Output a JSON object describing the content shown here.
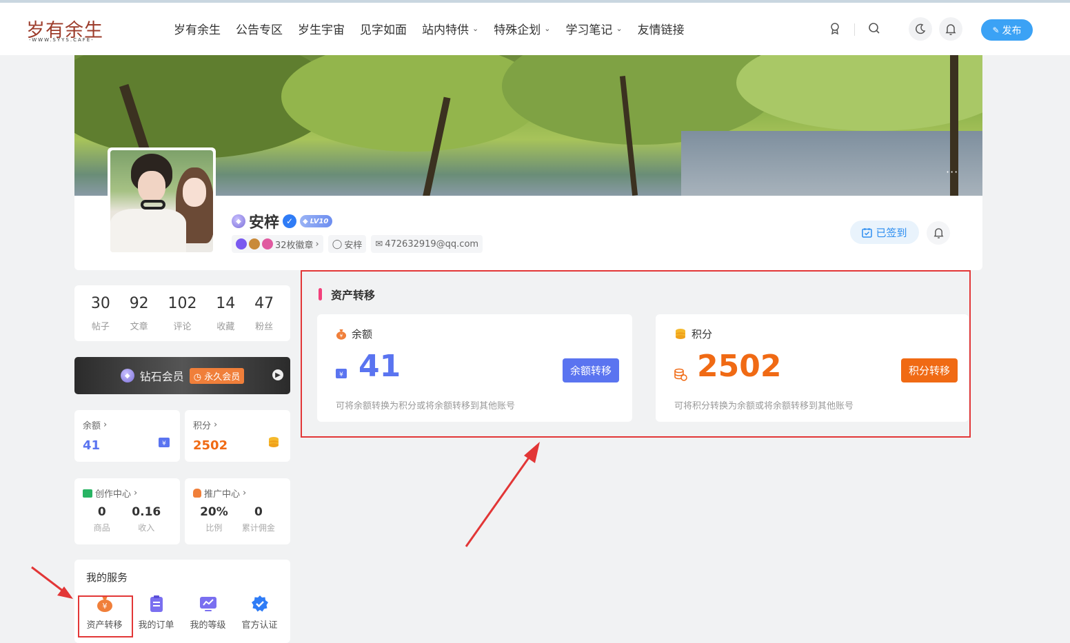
{
  "brand": {
    "logo_text": "岁有余生",
    "logo_sub": "-WWW.SYYS.CAFE-"
  },
  "nav": [
    {
      "label": "岁有余生",
      "dropdown": false
    },
    {
      "label": "公告专区",
      "dropdown": false
    },
    {
      "label": "岁生宇宙",
      "dropdown": false
    },
    {
      "label": "见字如面",
      "dropdown": false
    },
    {
      "label": "站内特供",
      "dropdown": true
    },
    {
      "label": "特殊企划",
      "dropdown": true
    },
    {
      "label": "学习笔记",
      "dropdown": true
    },
    {
      "label": "友情链接",
      "dropdown": false
    }
  ],
  "header": {
    "publish_label": "发布"
  },
  "profile": {
    "name": "安梓",
    "level": "LV10",
    "medal_text": "32枚徽章",
    "username": "安梓",
    "email": "472632919@qq.com",
    "signed_label": "已签到",
    "more": "···"
  },
  "stats": [
    {
      "value": "30",
      "label": "帖子"
    },
    {
      "value": "92",
      "label": "文章"
    },
    {
      "value": "102",
      "label": "评论"
    },
    {
      "value": "14",
      "label": "收藏"
    },
    {
      "value": "47",
      "label": "粉丝"
    }
  ],
  "vip": {
    "label": "钻石会员",
    "tag": "永久会员"
  },
  "balance": {
    "title": "余额",
    "value": "41"
  },
  "points": {
    "title": "积分",
    "value": "2502"
  },
  "creation": {
    "title": "创作中心",
    "items": [
      {
        "value": "0",
        "label": "商品"
      },
      {
        "value": "0.16",
        "label": "收入"
      }
    ]
  },
  "promotion": {
    "title": "推广中心",
    "items": [
      {
        "value": "20%",
        "label": "比例"
      },
      {
        "value": "0",
        "label": "累计佣金"
      }
    ]
  },
  "services": {
    "title": "我的服务",
    "items": [
      {
        "label": "资产转移",
        "icon": "money-bag-icon"
      },
      {
        "label": "我的订单",
        "icon": "clipboard-icon"
      },
      {
        "label": "我的等级",
        "icon": "chart-icon"
      },
      {
        "label": "官方认证",
        "icon": "verified-icon"
      }
    ]
  },
  "asset_transfer": {
    "title": "资产转移",
    "balance": {
      "title": "余额",
      "value": "41",
      "button": "余额转移",
      "desc": "可将余额转换为积分或将余额转移到其他账号"
    },
    "points": {
      "title": "积分",
      "value": "2502",
      "button": "积分转移",
      "desc": "可将积分转换为余额或将余额转移到其他账号"
    }
  },
  "colors": {
    "accent_blue": "#5a74f0",
    "accent_orange": "#f06a14",
    "highlight_red": "#e23636",
    "publish_blue": "#3ba2f5"
  }
}
